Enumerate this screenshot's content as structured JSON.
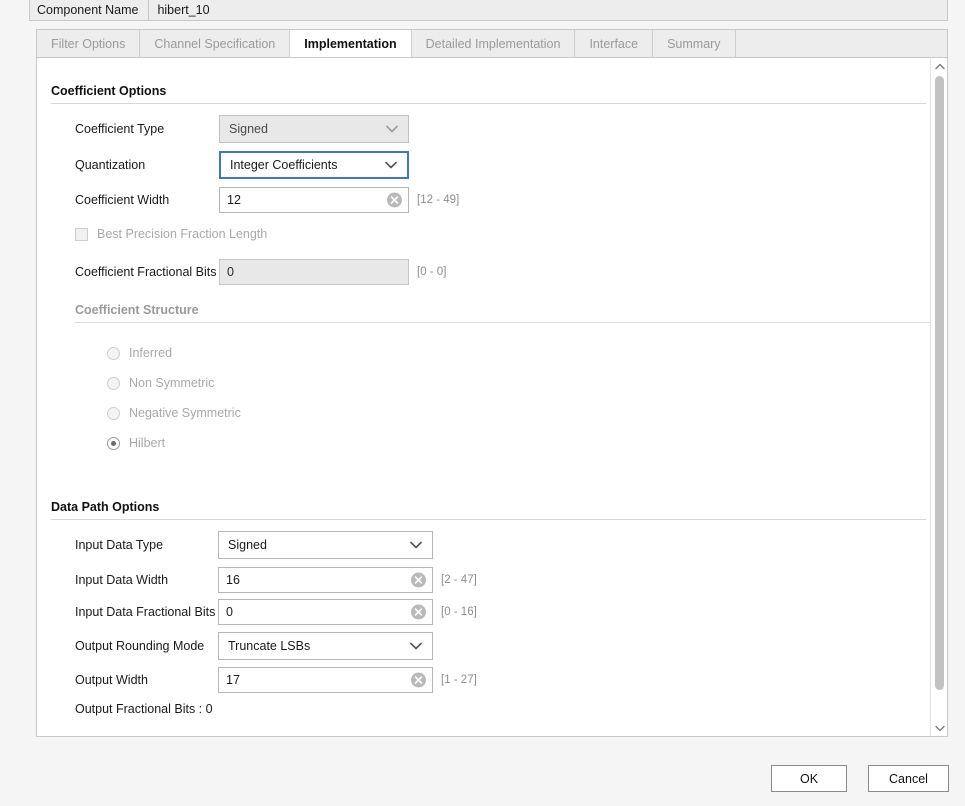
{
  "component": {
    "label": "Component Name",
    "value": "hibert_10"
  },
  "tabs": [
    {
      "label": "Filter Options",
      "active": false
    },
    {
      "label": "Channel Specification",
      "active": false
    },
    {
      "label": "Implementation",
      "active": true
    },
    {
      "label": "Detailed Implementation",
      "active": false
    },
    {
      "label": "Interface",
      "active": false
    },
    {
      "label": "Summary",
      "active": false
    }
  ],
  "coefficient_options": {
    "title": "Coefficient Options",
    "coefficient_type": {
      "label": "Coefficient Type",
      "value": "Signed",
      "state": "disabled"
    },
    "quantization": {
      "label": "Quantization",
      "value": "Integer Coefficients",
      "state": "focused"
    },
    "coefficient_width": {
      "label": "Coefficient Width",
      "value": "12",
      "range": "[12 - 49]",
      "state": "enabled"
    },
    "best_precision": {
      "label": "Best Precision Fraction Length",
      "checked": false,
      "state": "disabled"
    },
    "coefficient_fractional_bits": {
      "label": "Coefficient Fractional Bits",
      "value": "0",
      "range": "[0 - 0]",
      "state": "disabled"
    },
    "structure": {
      "title": "Coefficient Structure",
      "options": [
        {
          "label": "Inferred",
          "selected": false
        },
        {
          "label": "Non Symmetric",
          "selected": false
        },
        {
          "label": "Negative Symmetric",
          "selected": false
        },
        {
          "label": "Hilbert",
          "selected": true
        }
      ]
    }
  },
  "data_path_options": {
    "title": "Data Path Options",
    "input_data_type": {
      "label": "Input Data Type",
      "value": "Signed",
      "state": "enabled"
    },
    "input_data_width": {
      "label": "Input Data Width",
      "value": "16",
      "range": "[2 - 47]",
      "state": "enabled"
    },
    "input_data_fractional_bits": {
      "label": "Input Data Fractional Bits",
      "value": "0",
      "range": "[0 - 16]",
      "state": "enabled"
    },
    "output_rounding_mode": {
      "label": "Output Rounding Mode",
      "value": "Truncate LSBs",
      "state": "enabled"
    },
    "output_width": {
      "label": "Output Width",
      "value": "17",
      "range": "[1 - 27]",
      "state": "enabled"
    },
    "output_fractional_bits": {
      "text": "Output Fractional Bits : 0"
    }
  },
  "footer": {
    "ok": "OK",
    "cancel": "Cancel"
  },
  "colors": {
    "focus_border": "#3b78c3",
    "page_background": "#f5f5f5",
    "panel_background": "#ffffff",
    "disabled_text": "#a9a9a9",
    "hint_text": "#8e8e8e"
  }
}
